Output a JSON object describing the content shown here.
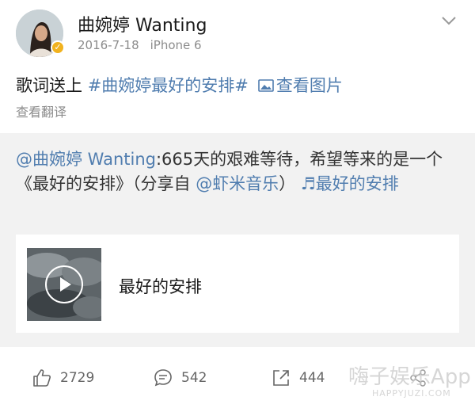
{
  "header": {
    "username": "曲婉婷 Wanting",
    "date": "2016-7-18",
    "device": "iPhone 6"
  },
  "post": {
    "text_plain": "歌词送上 ",
    "hashtag": "#曲婉婷最好的安排#",
    "picture_link": "查看图片",
    "translate": "查看翻译"
  },
  "repost": {
    "mention": "@曲婉婷 Wanting",
    "text_1": ":665天的艰难等待，希望等来的是一个《最好的安排》（分享自 ",
    "source_mention": "@虾米音乐",
    "text_2": "）",
    "music_link": "♬最好的安排",
    "card_title": "最好的安排"
  },
  "actions": {
    "likes": "2729",
    "comments": "542",
    "shares": "444"
  },
  "watermark": {
    "main": "嗨子娱乐App",
    "sub": "HAPPYJUZI.COM"
  },
  "colors": {
    "link": "#507daf",
    "verified_badge": "#f1b21e",
    "repost_bg": "#f2f2f2"
  }
}
